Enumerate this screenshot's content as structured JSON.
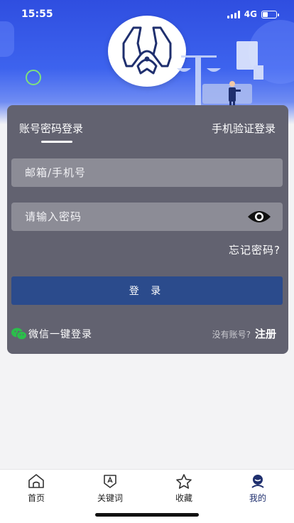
{
  "status_bar": {
    "time": "15:55",
    "network": "4G"
  },
  "hero": {
    "logo_icon": "eagle-shield-logo",
    "illustration_icon": "justice-scale-illustration"
  },
  "login": {
    "tabs": [
      {
        "label": "账号密码登录",
        "active": true
      },
      {
        "label": "手机验证登录",
        "active": false
      }
    ],
    "email_placeholder": "邮箱/手机号",
    "password_placeholder": "请输入密码",
    "forgot_label": "忘记密码?",
    "submit_label": "登 录",
    "wechat_label": "微信一键登录",
    "no_account_label": "没有账号?",
    "register_label": "注册"
  },
  "tabbar": {
    "items": [
      {
        "label": "首页",
        "icon": "home-icon",
        "active": false
      },
      {
        "label": "关键词",
        "icon": "keyword-icon",
        "active": false
      },
      {
        "label": "收藏",
        "icon": "star-icon",
        "active": false
      },
      {
        "label": "我的",
        "icon": "profile-icon",
        "active": true
      }
    ]
  },
  "colors": {
    "hero_blue": "#2f4ee0",
    "card_bg": "#626270",
    "input_bg": "#8c8c96",
    "button_blue": "#2b4b8c",
    "tab_active": "#1f2f6e",
    "wechat_green": "#2bbf4b"
  }
}
